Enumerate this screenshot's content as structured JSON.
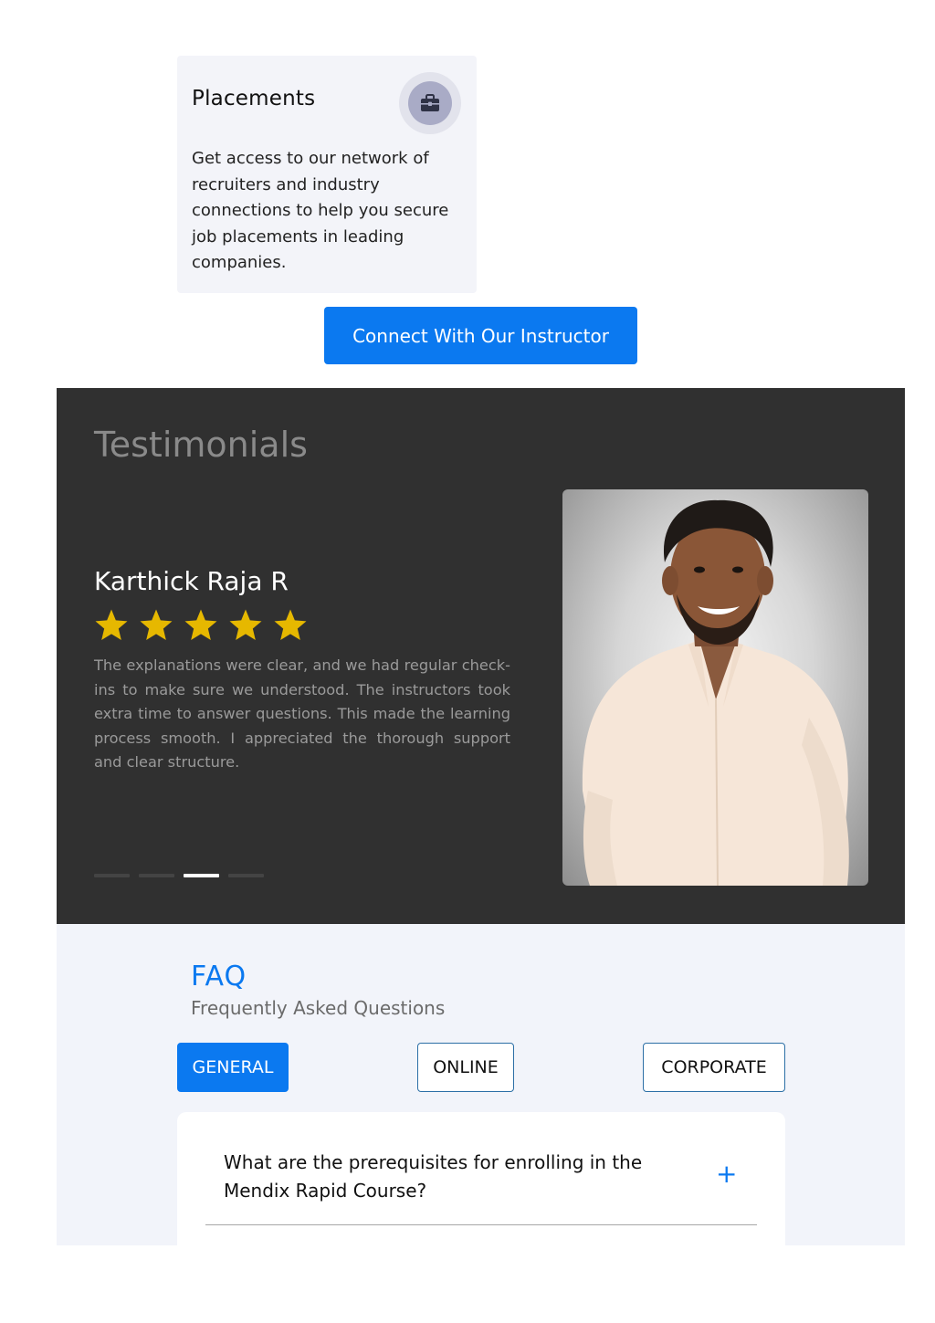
{
  "placements": {
    "title": "Placements",
    "icon": "briefcase-icon",
    "text": "Get access to our network of recruiters and industry connections to help you secure job placements in leading companies."
  },
  "cta": {
    "label": "Connect With Our Instructor"
  },
  "testimonials": {
    "heading": "Testimonials",
    "reviewer": "Karthick Raja R",
    "rating": 5,
    "review": "The explanations were clear, and we had regular check-ins to make sure we understood. The instructors took extra time to answer questions. This made the learning process smooth. I appreciated the thorough support and clear structure.",
    "slides": 4,
    "active_slide": 3
  },
  "faq": {
    "title": "FAQ",
    "subtitle": "Frequently Asked Questions",
    "tabs": [
      {
        "label": "GENERAL",
        "active": true
      },
      {
        "label": "ONLINE",
        "active": false
      },
      {
        "label": "CORPORATE",
        "active": false
      }
    ],
    "items": [
      {
        "question": "What are the prerequisites for enrolling in the Mendix Rapid Course?",
        "toggle": "+"
      }
    ]
  },
  "colors": {
    "accent": "#0b79f0",
    "star": "#e6b800",
    "testimonial_bg": "#303030",
    "faq_bg": "#f2f4fa"
  }
}
